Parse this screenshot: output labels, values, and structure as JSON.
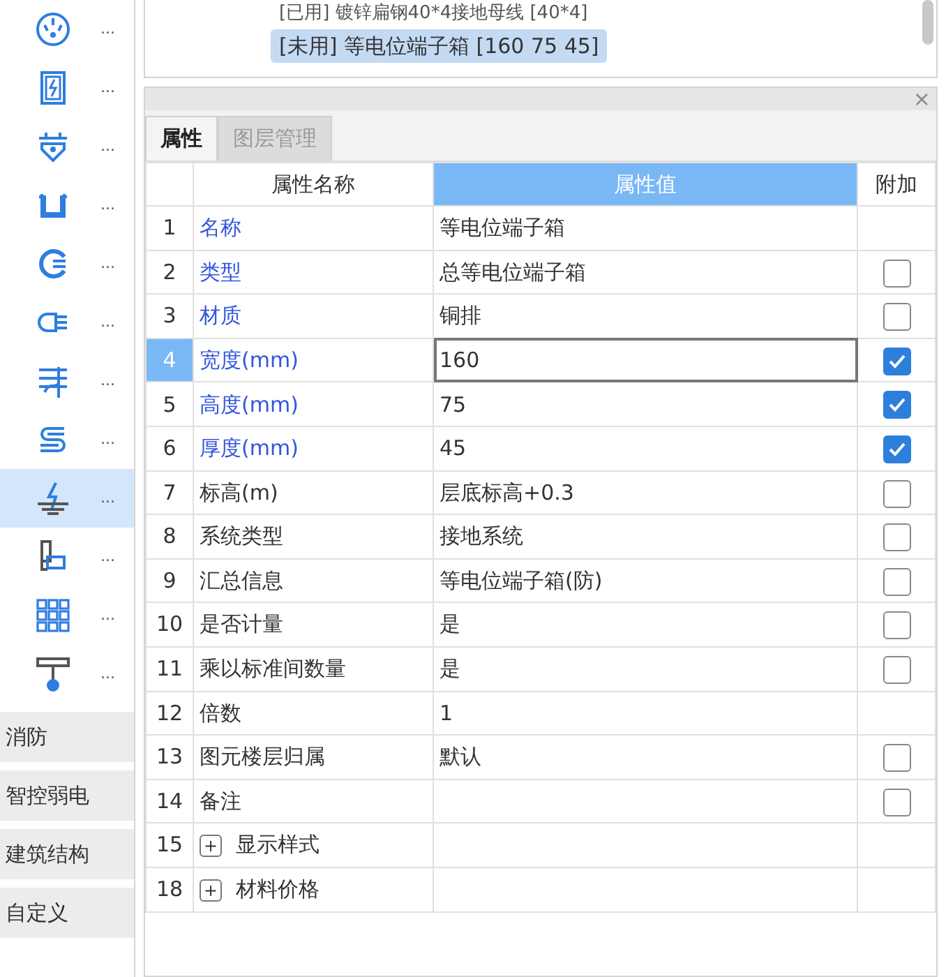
{
  "sidebar": {
    "tools": [
      {
        "more": "...",
        "selected": false
      },
      {
        "more": "...",
        "selected": false
      },
      {
        "more": "...",
        "selected": false
      },
      {
        "more": "...",
        "selected": false
      },
      {
        "more": "...",
        "selected": false
      },
      {
        "more": "...",
        "selected": false
      },
      {
        "more": "...",
        "selected": false
      },
      {
        "more": "...",
        "selected": false
      },
      {
        "more": "...",
        "selected": true
      },
      {
        "more": "...",
        "selected": false
      },
      {
        "more": "...",
        "selected": false
      },
      {
        "more": "...",
        "selected": false
      }
    ],
    "categories": [
      "消防",
      "智控弱电",
      "建筑结构",
      "自定义"
    ]
  },
  "component_list": {
    "items": [
      {
        "text": "[已用] 镀锌扁钢40*4接地母线 [40*4]",
        "selected": false
      },
      {
        "text": "[未用] 等电位端子箱 [160 75 45]",
        "selected": true
      }
    ]
  },
  "properties_panel": {
    "close": "×",
    "tabs": [
      {
        "label": "属性",
        "selected": true
      },
      {
        "label": "图层管理",
        "selected": false
      }
    ],
    "columns": [
      {
        "label": "属性名称",
        "selected": false
      },
      {
        "label": "属性值",
        "selected": true
      },
      {
        "label": "附加",
        "selected": false
      }
    ],
    "rows": [
      {
        "kind": "property",
        "num": "1",
        "name": "名称",
        "value": "等电位端子箱",
        "public": true,
        "selected": false
      },
      {
        "kind": "property",
        "num": "2",
        "name": "类型",
        "value": "总等电位端子箱",
        "public": true,
        "selected": false,
        "attached": false
      },
      {
        "kind": "property",
        "num": "3",
        "name": "材质",
        "value": "铜排",
        "public": true,
        "selected": false,
        "attached": false
      },
      {
        "kind": "property",
        "num": "4",
        "name": "宽度(mm)",
        "value": "160",
        "public": true,
        "selected": true,
        "attached": true
      },
      {
        "kind": "property",
        "num": "5",
        "name": "高度(mm)",
        "value": "75",
        "public": true,
        "selected": false,
        "attached": true
      },
      {
        "kind": "property",
        "num": "6",
        "name": "厚度(mm)",
        "value": "45",
        "public": true,
        "selected": false,
        "attached": true
      },
      {
        "kind": "property",
        "num": "7",
        "name": "标高(m)",
        "value": "层底标高+0.3",
        "public": false,
        "selected": false,
        "attached": false
      },
      {
        "kind": "property",
        "num": "8",
        "name": "系统类型",
        "value": "接地系统",
        "public": false,
        "selected": false,
        "attached": false
      },
      {
        "kind": "property",
        "num": "9",
        "name": "汇总信息",
        "value": "等电位端子箱(防)",
        "public": false,
        "selected": false,
        "attached": false
      },
      {
        "kind": "property",
        "num": "10",
        "name": "是否计量",
        "value": "是",
        "public": false,
        "selected": false,
        "attached": false
      },
      {
        "kind": "property",
        "num": "11",
        "name": "乘以标准间数量",
        "value": "是",
        "public": false,
        "selected": false,
        "attached": false
      },
      {
        "kind": "property",
        "num": "12",
        "name": "倍数",
        "value": "1",
        "public": false,
        "selected": false
      },
      {
        "kind": "property",
        "num": "13",
        "name": "图元楼层归属",
        "value": "默认",
        "public": false,
        "selected": false,
        "attached": false
      },
      {
        "kind": "property",
        "num": "14",
        "name": "备注",
        "public": false,
        "selected": false,
        "attached": false
      },
      {
        "kind": "group",
        "num": "15",
        "name": "显示样式",
        "expander": "+",
        "expanded": false,
        "selected": false
      },
      {
        "kind": "group",
        "num": "18",
        "name": "材料价格",
        "expander": "+",
        "expanded": false,
        "selected": false
      }
    ]
  }
}
